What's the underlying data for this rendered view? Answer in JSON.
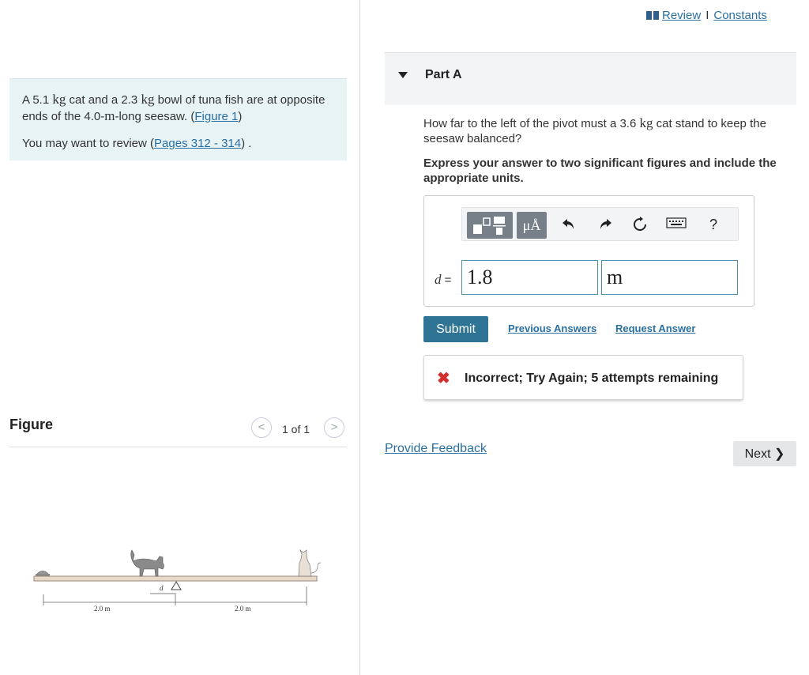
{
  "header": {
    "review_label": "Review",
    "separator": "I",
    "constants_label": "Constants"
  },
  "problem": {
    "text_part1": "A 5.1 ",
    "unit_kg_1": "kg",
    "text_part2": " cat and a 2.3 ",
    "unit_kg_2": "kg",
    "text_part3": " bowl of tuna fish are at opposite ends of the 4.0-",
    "unit_m": "m",
    "text_part4": "-long seesaw. (",
    "figure_link": "Figure 1",
    "text_part5": ")",
    "review_prefix": "You may want to review (",
    "pages_link": "Pages 312 - 314",
    "review_suffix": ") ."
  },
  "figure": {
    "title": "Figure",
    "prev": "<",
    "next": ">",
    "count": "1 of 1",
    "label_d": "d",
    "label_left_dist": "2.0 m",
    "label_right_dist": "2.0 m"
  },
  "part": {
    "title": "Part A",
    "question_part1": "How far to the left of the pivot must a 3.6 ",
    "question_unit": "kg",
    "question_part2": " cat stand to keep the seesaw balanced?",
    "instructions": "Express your answer to two significant figures and include the appropriate units."
  },
  "toolbar": {
    "units_label": "μÅ",
    "help_label": "?"
  },
  "answer": {
    "variable": "d",
    "equals": "=",
    "value": "1.8",
    "unit": "m"
  },
  "actions": {
    "submit_label": "Submit",
    "previous_answers_label": "Previous Answers",
    "request_answer_label": "Request Answer"
  },
  "feedback": {
    "icon": "✖",
    "message": "Incorrect; Try Again; 5 attempts remaining"
  },
  "footer": {
    "provide_feedback_label": "Provide Feedback",
    "next_label": "Next ❯"
  },
  "colors": {
    "accent": "#2f7494",
    "link": "#2a6fa1",
    "error": "#d32f2f",
    "problem_bg": "#e8f3f6"
  }
}
